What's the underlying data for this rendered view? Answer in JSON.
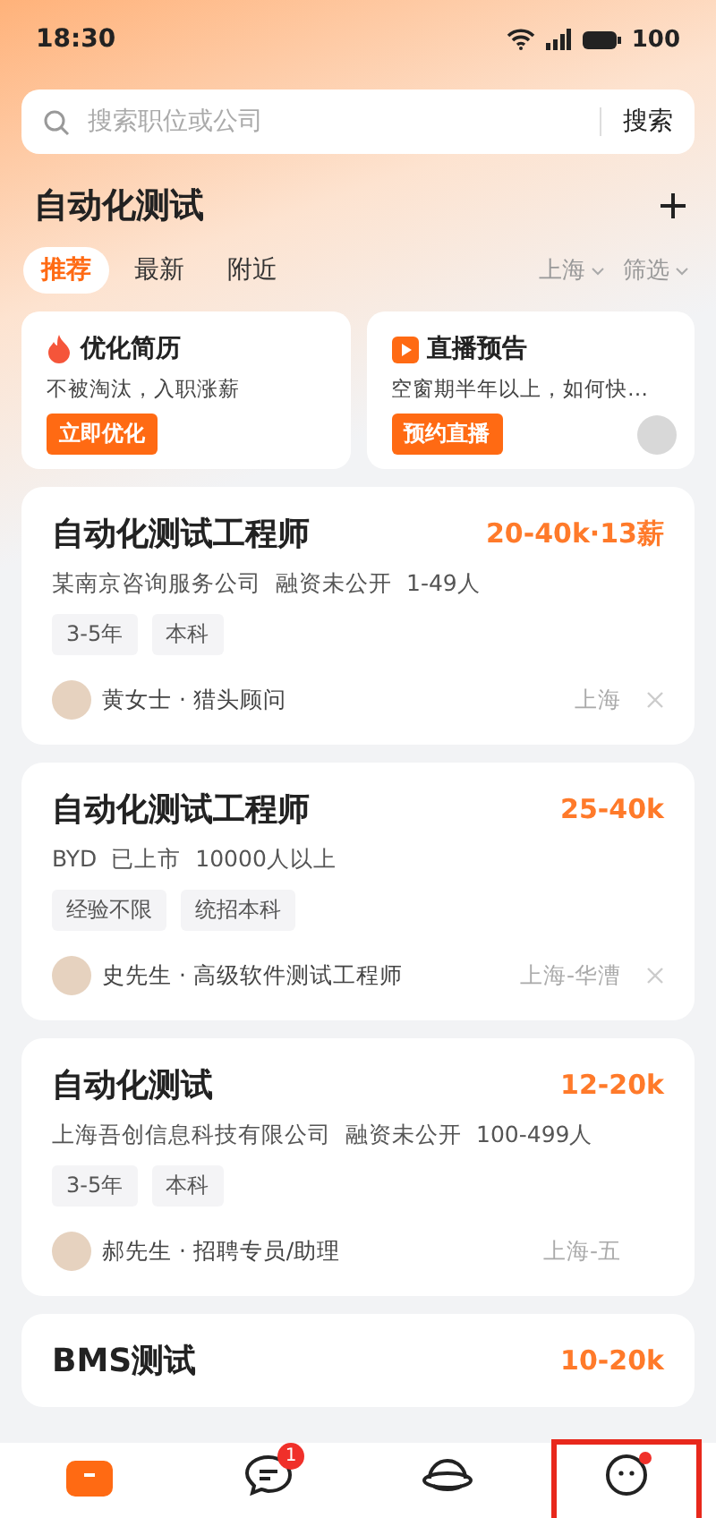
{
  "status_bar": {
    "time": "18:30",
    "battery": "100"
  },
  "search": {
    "placeholder": "搜索职位或公司",
    "button": "搜索"
  },
  "header": {
    "title": "自动化测试"
  },
  "tabs": [
    {
      "label": "推荐",
      "selected": true
    },
    {
      "label": "最新",
      "selected": false
    },
    {
      "label": "附近",
      "selected": false
    }
  ],
  "filters": [
    "上海",
    "筛选"
  ],
  "promos": [
    {
      "kind": "fire",
      "title": "优化简历",
      "subtitle": "不被淘汰，入职涨薪",
      "button": "立即优化",
      "avatar": false
    },
    {
      "kind": "live",
      "title": "直播预告",
      "subtitle": "空窗期半年以上，如何快…",
      "button": "预约直播",
      "avatar": true
    }
  ],
  "jobs": [
    {
      "title": "自动化测试工程师",
      "salary": "20-40k·13薪",
      "company": [
        "某南京咨询服务公司",
        "融资未公开",
        "1-49人"
      ],
      "tags": [
        "3-5年",
        "本科"
      ],
      "recruiter": "黄女士 · 猎头顾问",
      "location": "上海",
      "dismiss": true
    },
    {
      "title": "自动化测试工程师",
      "salary": "25-40k",
      "company": [
        "BYD",
        "已上市",
        "10000人以上"
      ],
      "tags": [
        "经验不限",
        "统招本科"
      ],
      "recruiter": "史先生 · 高级软件测试工程师",
      "location": "上海-华漕",
      "dismiss": true
    },
    {
      "title": "自动化测试",
      "salary": "12-20k",
      "company": [
        "上海吾创信息科技有限公司",
        "融资未公开",
        "100-499人"
      ],
      "tags": [
        "3-5年",
        "本科"
      ],
      "recruiter": "郝先生 · 招聘专员/助理",
      "location": "上海-五",
      "dismiss": false
    },
    {
      "title": "BMS测试",
      "salary": "10-20k"
    }
  ],
  "nav": [
    {
      "kind": "briefcase",
      "selected": true,
      "dot": false,
      "highlighted": false
    },
    {
      "kind": "chat",
      "selected": false,
      "badge": "1",
      "dot": false,
      "highlighted": false
    },
    {
      "kind": "planet",
      "selected": false,
      "dot": false,
      "highlighted": false
    },
    {
      "kind": "face",
      "selected": false,
      "dot": true,
      "highlighted": true
    }
  ]
}
